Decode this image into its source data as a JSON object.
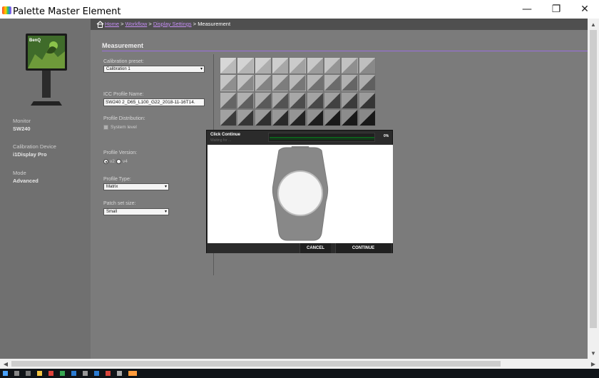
{
  "window": {
    "title": "Palette Master Element",
    "minimize_glyph": "—",
    "restore_glyph": "❐",
    "close_glyph": "✕"
  },
  "sidebar": {
    "monitor_label": "Monitor",
    "monitor_value": "SW240",
    "device_label": "Calibration Device",
    "device_value": "i1Display Pro",
    "mode_label": "Mode",
    "mode_value": "Advanced",
    "brand": "BenQ"
  },
  "breadcrumb": {
    "home": "Home",
    "sep1": " > ",
    "workflow": "Workflow",
    "sep2": " > ",
    "display_settings": "Display Settings",
    "sep3": " > ",
    "current": "Measurement"
  },
  "measurement": {
    "section_title": "Measurement",
    "calibration_preset_label": "Calibration preset:",
    "calibration_preset_value": "Calibration 1",
    "icc_profile_label": "ICC Profile Name:",
    "icc_profile_value": "SW240 2_D65_L100_G22_2018-11-16T14.",
    "profile_distribution_label": "Profile Distribution:",
    "system_level_label": "System level",
    "profile_version_label": "Profile Version:",
    "version_v2": "v2",
    "version_v4": "v4",
    "profile_type_label": "Profile Type:",
    "profile_type_value": "Matrix",
    "patch_set_label": "Patch set size:",
    "patch_set_value": "Small"
  },
  "dialog": {
    "title": "Click Continue",
    "subtitle": "Waiting for ...",
    "progress_percent": "0%",
    "progress_value": 0.99,
    "cancel_label": "CANCEL",
    "continue_label": "CONTINUE"
  },
  "colors": {
    "accent": "#9b6fe0",
    "link": "#c58ef5",
    "sidebar_bg": "#707070",
    "main_bg": "#7b7b7b"
  }
}
